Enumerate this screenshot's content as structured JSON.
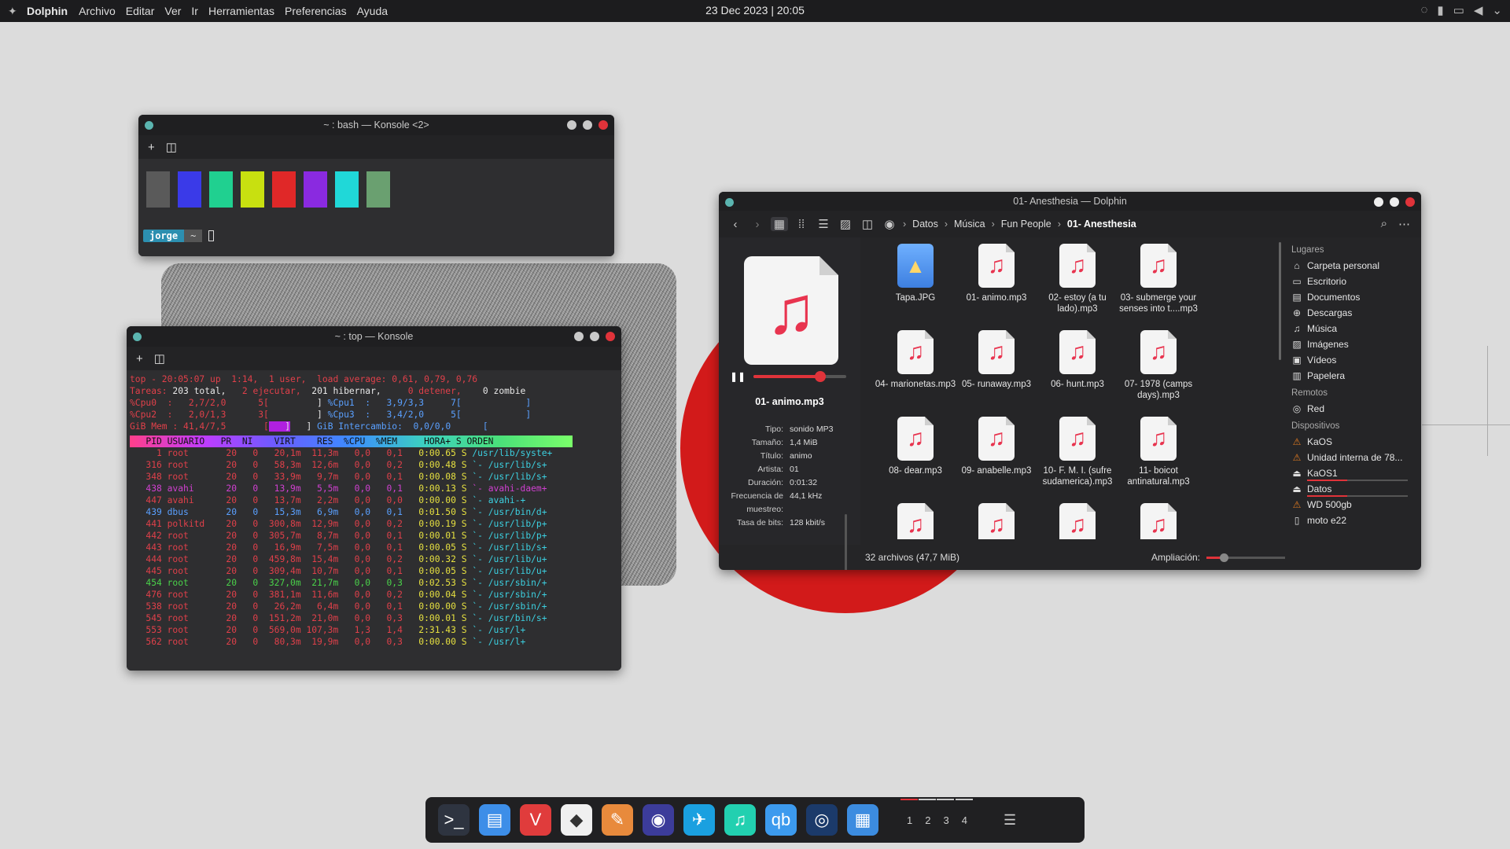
{
  "topbar": {
    "app": "Dolphin",
    "menus": [
      "Archivo",
      "Editar",
      "Ver",
      "Ir",
      "Herramientas",
      "Preferencias",
      "Ayuda"
    ],
    "clock": "23 Dec 2023 | 20:05"
  },
  "konsole1": {
    "title": "~ : bash — Konsole <2>",
    "swatches": [
      "#5a5a5a",
      "#3a3ae8",
      "#20d090",
      "#c8e010",
      "#e02828",
      "#8a2ae0",
      "#20d8d8",
      "#6aa070"
    ],
    "prompt_user": "jorge",
    "prompt_dir": "~"
  },
  "konsole2": {
    "title": "~ : top — Konsole",
    "line1": "top - 20:05:07 up  1:14,  1 user,  load average: 0,61, 0,79, 0,76",
    "line2_a": "Tareas: ",
    "line2_b": "203 total,",
    "line2_c": "   2 ejecutar, ",
    "line2_d": " 201 hibernar,",
    "line2_e": "     0 detener,",
    "line2_f": "    0 zombie",
    "cpu0": "%Cpu0  :   2,7/2,0      5[",
    "cpu0b": "         ]",
    "cpu1": "%Cpu1  :   3,9/3,3     7[            ]",
    "cpu2": "%Cpu2  :   2,0/1,3      3[",
    "cpu2b": "         ]",
    "cpu3": "%Cpu3  :   3,4/2,0     5[            ]",
    "mem": "GiB Mem : 41,4/7,5       [",
    "memb": "   ]",
    "swap": "GiB Intercambio:  0,0/0,0      [",
    "header": "   PID USUARIO   PR  NI    VIRT    RES  %CPU  %MEM     HORA+ S ORDEN",
    "rows": [
      {
        "pid": "1",
        "user": "root",
        "pr": "20",
        "ni": "0",
        "virt": "20,1m",
        "res": "11,3m",
        "cpu": "0,0",
        "mem": "0,1",
        "time": "0:00.65",
        "s": "S",
        "cmd": "/usr/lib/syste+",
        "cls": "c-red"
      },
      {
        "pid": "316",
        "user": "root",
        "pr": "20",
        "ni": "0",
        "virt": "58,3m",
        "res": "12,6m",
        "cpu": "0,0",
        "mem": "0,2",
        "time": "0:00.48",
        "s": "S",
        "cmd": "`- /usr/lib/s+",
        "cls": "c-red"
      },
      {
        "pid": "348",
        "user": "root",
        "pr": "20",
        "ni": "0",
        "virt": "33,9m",
        "res": "9,7m",
        "cpu": "0,0",
        "mem": "0,1",
        "time": "0:00.08",
        "s": "S",
        "cmd": "`- /usr/lib/s+",
        "cls": "c-red"
      },
      {
        "pid": "438",
        "user": "avahi",
        "pr": "20",
        "ni": "0",
        "virt": "13,9m",
        "res": "5,5m",
        "cpu": "0,0",
        "mem": "0,1",
        "time": "0:00.13",
        "s": "S",
        "cmd": "`- avahi-daem+",
        "cls": "c-mag"
      },
      {
        "pid": "447",
        "user": "avahi",
        "pr": "20",
        "ni": "0",
        "virt": "13,7m",
        "res": "2,2m",
        "cpu": "0,0",
        "mem": "0,0",
        "time": "0:00.00",
        "s": "S",
        "cmd": "`- avahi-+",
        "cls": "c-red"
      },
      {
        "pid": "439",
        "user": "dbus",
        "pr": "20",
        "ni": "0",
        "virt": "15,3m",
        "res": "6,9m",
        "cpu": "0,0",
        "mem": "0,1",
        "time": "0:01.50",
        "s": "S",
        "cmd": "`- /usr/bin/d+",
        "cls": "c-blu"
      },
      {
        "pid": "441",
        "user": "polkitd",
        "pr": "20",
        "ni": "0",
        "virt": "300,8m",
        "res": "12,9m",
        "cpu": "0,0",
        "mem": "0,2",
        "time": "0:00.19",
        "s": "S",
        "cmd": "`- /usr/lib/p+",
        "cls": "c-red"
      },
      {
        "pid": "442",
        "user": "root",
        "pr": "20",
        "ni": "0",
        "virt": "305,7m",
        "res": "8,7m",
        "cpu": "0,0",
        "mem": "0,1",
        "time": "0:00.01",
        "s": "S",
        "cmd": "`- /usr/lib/p+",
        "cls": "c-red"
      },
      {
        "pid": "443",
        "user": "root",
        "pr": "20",
        "ni": "0",
        "virt": "16,9m",
        "res": "7,5m",
        "cpu": "0,0",
        "mem": "0,1",
        "time": "0:00.05",
        "s": "S",
        "cmd": "`- /usr/lib/s+",
        "cls": "c-red"
      },
      {
        "pid": "444",
        "user": "root",
        "pr": "20",
        "ni": "0",
        "virt": "459,8m",
        "res": "15,4m",
        "cpu": "0,0",
        "mem": "0,2",
        "time": "0:00.32",
        "s": "S",
        "cmd": "`- /usr/lib/u+",
        "cls": "c-red"
      },
      {
        "pid": "445",
        "user": "root",
        "pr": "20",
        "ni": "0",
        "virt": "309,4m",
        "res": "10,7m",
        "cpu": "0,0",
        "mem": "0,1",
        "time": "0:00.05",
        "s": "S",
        "cmd": "`- /usr/lib/u+",
        "cls": "c-red"
      },
      {
        "pid": "454",
        "user": "root",
        "pr": "20",
        "ni": "0",
        "virt": "327,0m",
        "res": "21,7m",
        "cpu": "0,0",
        "mem": "0,3",
        "time": "0:02.53",
        "s": "S",
        "cmd": "`- /usr/sbin/+",
        "cls": "c-grn"
      },
      {
        "pid": "476",
        "user": "root",
        "pr": "20",
        "ni": "0",
        "virt": "381,1m",
        "res": "11,6m",
        "cpu": "0,0",
        "mem": "0,2",
        "time": "0:00.04",
        "s": "S",
        "cmd": "`- /usr/sbin/+",
        "cls": "c-red"
      },
      {
        "pid": "538",
        "user": "root",
        "pr": "20",
        "ni": "0",
        "virt": "26,2m",
        "res": "6,4m",
        "cpu": "0,0",
        "mem": "0,1",
        "time": "0:00.00",
        "s": "S",
        "cmd": "`- /usr/sbin/+",
        "cls": "c-red"
      },
      {
        "pid": "545",
        "user": "root",
        "pr": "20",
        "ni": "0",
        "virt": "151,2m",
        "res": "21,0m",
        "cpu": "0,0",
        "mem": "0,3",
        "time": "0:00.01",
        "s": "S",
        "cmd": "`- /usr/bin/s+",
        "cls": "c-red"
      },
      {
        "pid": "553",
        "user": "root",
        "pr": "20",
        "ni": "0",
        "virt": "569,0m",
        "res": "107,3m",
        "cpu": "1,3",
        "mem": "1,4",
        "time": "2:31.43",
        "s": "S",
        "cmd": "`- /usr/l+",
        "cls": "c-red"
      },
      {
        "pid": "562",
        "user": "root",
        "pr": "20",
        "ni": "0",
        "virt": "80,3m",
        "res": "19,9m",
        "cpu": "0,0",
        "mem": "0,3",
        "time": "0:00.00",
        "s": "S",
        "cmd": "`- /usr/l+",
        "cls": "c-red"
      }
    ]
  },
  "dolphin": {
    "title": "01- Anesthesia — Dolphin",
    "breadcrumbs": [
      "Datos",
      "Música",
      "Fun People",
      "01- Anesthesia"
    ],
    "preview_name": "01- animo.mp3",
    "seek_fraction": 0.72,
    "meta": [
      {
        "k": "Tipo:",
        "v": "sonido MP3"
      },
      {
        "k": "Tamaño:",
        "v": "1,4 MiB"
      },
      {
        "k": "Título:",
        "v": "animo"
      },
      {
        "k": "Artista:",
        "v": "01"
      },
      {
        "k": "Duración:",
        "v": "0:01:32"
      },
      {
        "k": "Frecuencia de muestreo:",
        "v": "44,1 kHz"
      },
      {
        "k": "Tasa de bits:",
        "v": "128 kbit/s"
      }
    ],
    "files": [
      {
        "name": "Tapa.JPG",
        "type": "image"
      },
      {
        "name": "01- animo.mp3",
        "type": "audio"
      },
      {
        "name": "02- estoy (a tu lado).mp3",
        "type": "audio"
      },
      {
        "name": "03- submerge your senses into t....mp3",
        "type": "audio"
      },
      {
        "name": "04- marionetas.mp3",
        "type": "audio"
      },
      {
        "name": "05- runaway.mp3",
        "type": "audio"
      },
      {
        "name": "06- hunt.mp3",
        "type": "audio"
      },
      {
        "name": "07- 1978 (camps days).mp3",
        "type": "audio"
      },
      {
        "name": "08- dear.mp3",
        "type": "audio"
      },
      {
        "name": "09- anabelle.mp3",
        "type": "audio"
      },
      {
        "name": "10- F. M. I. (sufre sudamerica).mp3",
        "type": "audio"
      },
      {
        "name": "11- boicot antinatural.mp3",
        "type": "audio"
      },
      {
        "name": "",
        "type": "audio"
      },
      {
        "name": "",
        "type": "audio"
      },
      {
        "name": "",
        "type": "audio"
      },
      {
        "name": "",
        "type": "audio"
      }
    ],
    "status": "32 archivos (47,7 MiB)",
    "zoom_label": "Ampliación:",
    "zoom_fraction": 0.22,
    "places_header": "Lugares",
    "places": [
      {
        "label": "Carpeta personal",
        "icon": "home-icon",
        "glyph": "⌂"
      },
      {
        "label": "Escritorio",
        "icon": "desktop-icon",
        "glyph": "▭"
      },
      {
        "label": "Documentos",
        "icon": "documents-icon",
        "glyph": "▤"
      },
      {
        "label": "Descargas",
        "icon": "download-icon",
        "glyph": "⊕"
      },
      {
        "label": "Música",
        "icon": "music-icon",
        "glyph": "♫"
      },
      {
        "label": "Imágenes",
        "icon": "images-icon",
        "glyph": "▨"
      },
      {
        "label": "Vídeos",
        "icon": "videos-icon",
        "glyph": "▣"
      },
      {
        "label": "Papelera",
        "icon": "trash-icon",
        "glyph": "▥"
      }
    ],
    "remote_header": "Remotos",
    "remote": [
      {
        "label": "Red",
        "icon": "network-icon",
        "glyph": "◎"
      }
    ],
    "devices_header": "Dispositivos",
    "devices": [
      {
        "label": "KaOS",
        "icon": "drive-warning-icon",
        "glyph": "⚠",
        "warn": true
      },
      {
        "label": "Unidad interna de 78...",
        "icon": "drive-warning-icon",
        "glyph": "⚠",
        "warn": true
      },
      {
        "label": "KaOS1",
        "icon": "drive-icon",
        "glyph": "⏏",
        "bar": true
      },
      {
        "label": "Datos",
        "icon": "drive-icon",
        "glyph": "⏏",
        "bar": true
      },
      {
        "label": "WD 500gb",
        "icon": "drive-warning-icon",
        "glyph": "⚠",
        "warn": true
      },
      {
        "label": "moto e22",
        "icon": "phone-icon",
        "glyph": "▯"
      }
    ]
  },
  "dock": {
    "apps": [
      {
        "name": "terminal-app",
        "glyph": ">_",
        "bg": "#2e3440"
      },
      {
        "name": "dolphin-app",
        "glyph": "▤",
        "bg": "#3d8ee8",
        "sel": true
      },
      {
        "name": "vivaldi-app",
        "glyph": "V",
        "bg": "#e03c3c"
      },
      {
        "name": "inkscape-app",
        "glyph": "◆",
        "bg": "#f0f0f0"
      },
      {
        "name": "gimp-app",
        "glyph": "✎",
        "bg": "#e88a3c"
      },
      {
        "name": "vpn-app",
        "glyph": "◉",
        "bg": "#3c3c9a"
      },
      {
        "name": "swift-app",
        "glyph": "✈",
        "bg": "#1aa0e0"
      },
      {
        "name": "music-app",
        "glyph": "♫",
        "bg": "#22d0b0"
      },
      {
        "name": "qbittorrent-app",
        "glyph": "qb",
        "bg": "#3c9aee"
      },
      {
        "name": "steam-app",
        "glyph": "◎",
        "bg": "#1b3a6a"
      },
      {
        "name": "discover-app",
        "glyph": "▦",
        "bg": "#3c8ce0"
      }
    ],
    "desktops": [
      "1",
      "2",
      "3",
      "4"
    ]
  }
}
